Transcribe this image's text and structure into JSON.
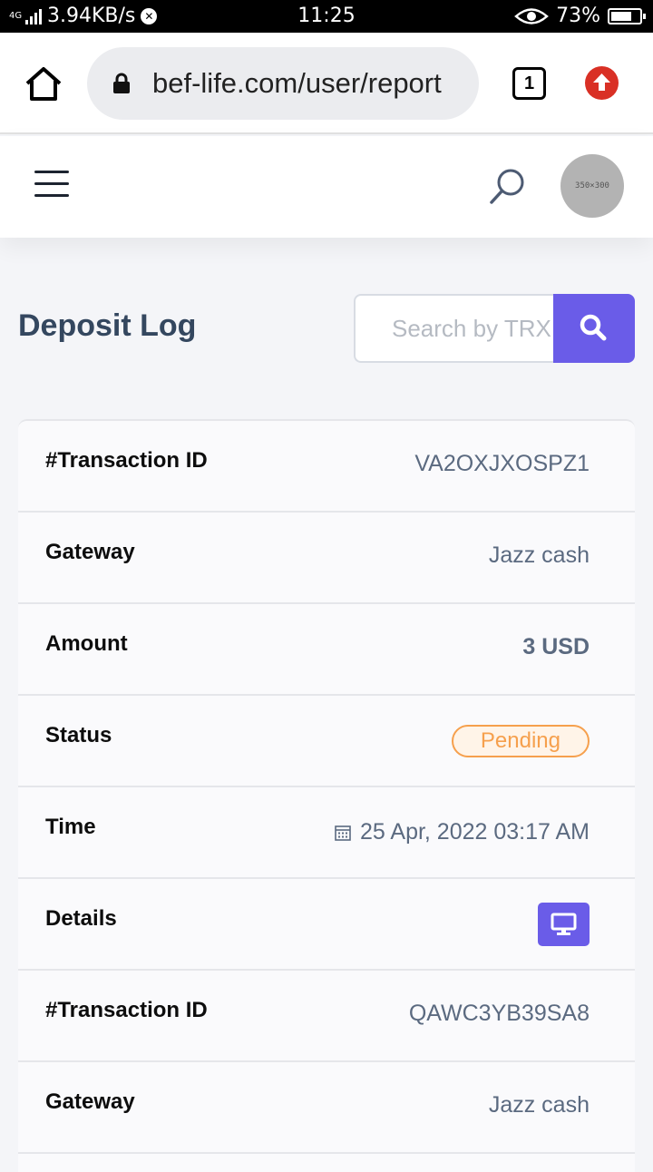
{
  "status_bar": {
    "network": "4G",
    "speed": "3.94KB/s",
    "time": "11:25",
    "battery": "73%",
    "battery_level": 0.73
  },
  "browser": {
    "url": "bef-life.com/user/report",
    "tab_count": "1",
    "icons": [
      "home-icon",
      "lock-icon",
      "tabs-icon",
      "upload-icon"
    ]
  },
  "header": {
    "avatar_placeholder": "350×300",
    "icons": [
      "hamburger-menu-icon",
      "search-icon"
    ]
  },
  "main": {
    "title": "Deposit Log",
    "search": {
      "placeholder": "Search by TRX",
      "value": ""
    }
  },
  "log": {
    "labels": {
      "transaction_id": "#Transaction ID",
      "gateway": "Gateway",
      "amount": "Amount",
      "status": "Status",
      "time": "Time",
      "details": "Details"
    },
    "records": [
      {
        "transaction_id": "VA2OXJXOSPZ1",
        "gateway": "Jazz cash",
        "amount": "3 USD",
        "status": "Pending",
        "time": "25 Apr, 2022 03:17 AM"
      },
      {
        "transaction_id": "QAWC3YB39SA8",
        "gateway": "Jazz cash"
      }
    ]
  },
  "colors": {
    "accent": "#6a5ce8",
    "pending": "#f6a04d",
    "title": "#34475f",
    "value": "#5b6a80"
  }
}
